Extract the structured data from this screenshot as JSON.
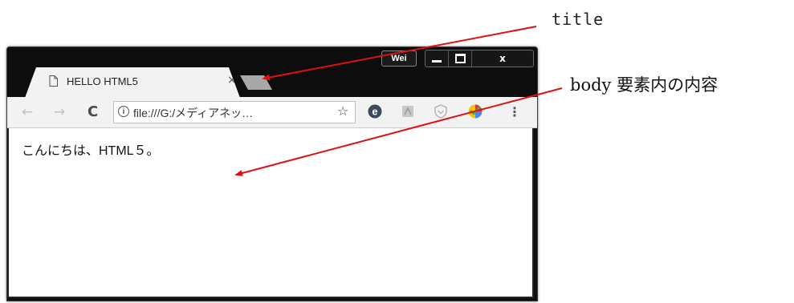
{
  "window": {
    "profile_label": "Wei",
    "controls": {
      "minimize": "minimize",
      "maximize": "maximize",
      "close": "x"
    }
  },
  "tab": {
    "title": "HELLO HTML5",
    "close": "×"
  },
  "toolbar": {
    "back": "←",
    "forward": "→",
    "reload": "C",
    "info_icon": "i",
    "url": "file:///G:/メディアネッ…",
    "star": "☆",
    "menu": "⋮",
    "extensions": [
      "e-icon",
      "pdf-icon",
      "shield-icon",
      "chrome-colorful-icon"
    ]
  },
  "page": {
    "content": "こんにちは、HTML５。"
  },
  "annotations": {
    "title_label": "title",
    "body_label": "body 要素内の内容",
    "arrow_color": "#e01010"
  }
}
